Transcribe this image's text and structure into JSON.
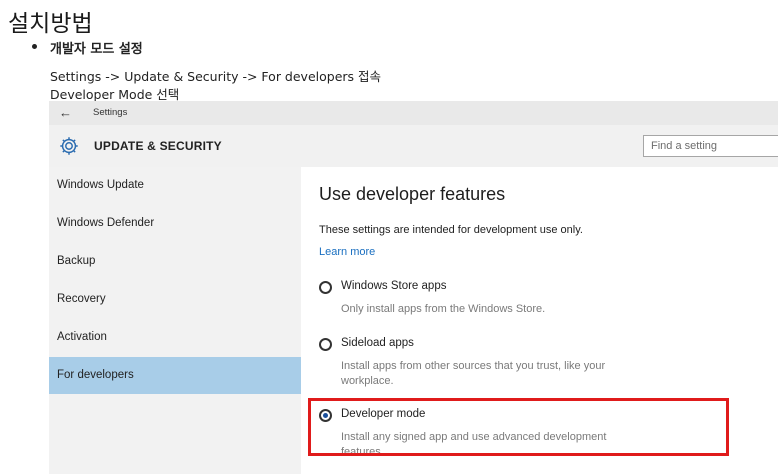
{
  "doc": {
    "title": "설치방법",
    "bullet_heading": "개발자 모드 설정",
    "line1": "Settings -> Update & Security -> For developers 접속",
    "line2": "Developer Mode 선택"
  },
  "settings_window": {
    "window_title": "Settings",
    "back_icon": "back-arrow-icon",
    "section_icon": "gear-icon",
    "section_title": "UPDATE & SECURITY",
    "search_placeholder": "Find a setting",
    "sidebar": {
      "items": [
        {
          "label": "Windows Update",
          "active": false
        },
        {
          "label": "Windows Defender",
          "active": false
        },
        {
          "label": "Backup",
          "active": false
        },
        {
          "label": "Recovery",
          "active": false
        },
        {
          "label": "Activation",
          "active": false
        },
        {
          "label": "For developers",
          "active": true
        }
      ]
    },
    "content": {
      "title": "Use developer features",
      "description": "These settings are intended for development use only.",
      "learn_more": "Learn more",
      "options": [
        {
          "label": "Windows Store apps",
          "sub": "Only install apps from the Windows Store.",
          "selected": false
        },
        {
          "label": "Sideload apps",
          "sub": "Install apps from other sources that you trust, like your workplace.",
          "selected": false
        },
        {
          "label": "Developer mode",
          "sub": "Install any signed app and use advanced development features.",
          "selected": true
        }
      ]
    },
    "colors": {
      "active_nav": "#a8cde8",
      "link": "#1a6fc0",
      "highlight_border": "#e01b1b",
      "gear_icon": "#2b6cb0"
    }
  }
}
